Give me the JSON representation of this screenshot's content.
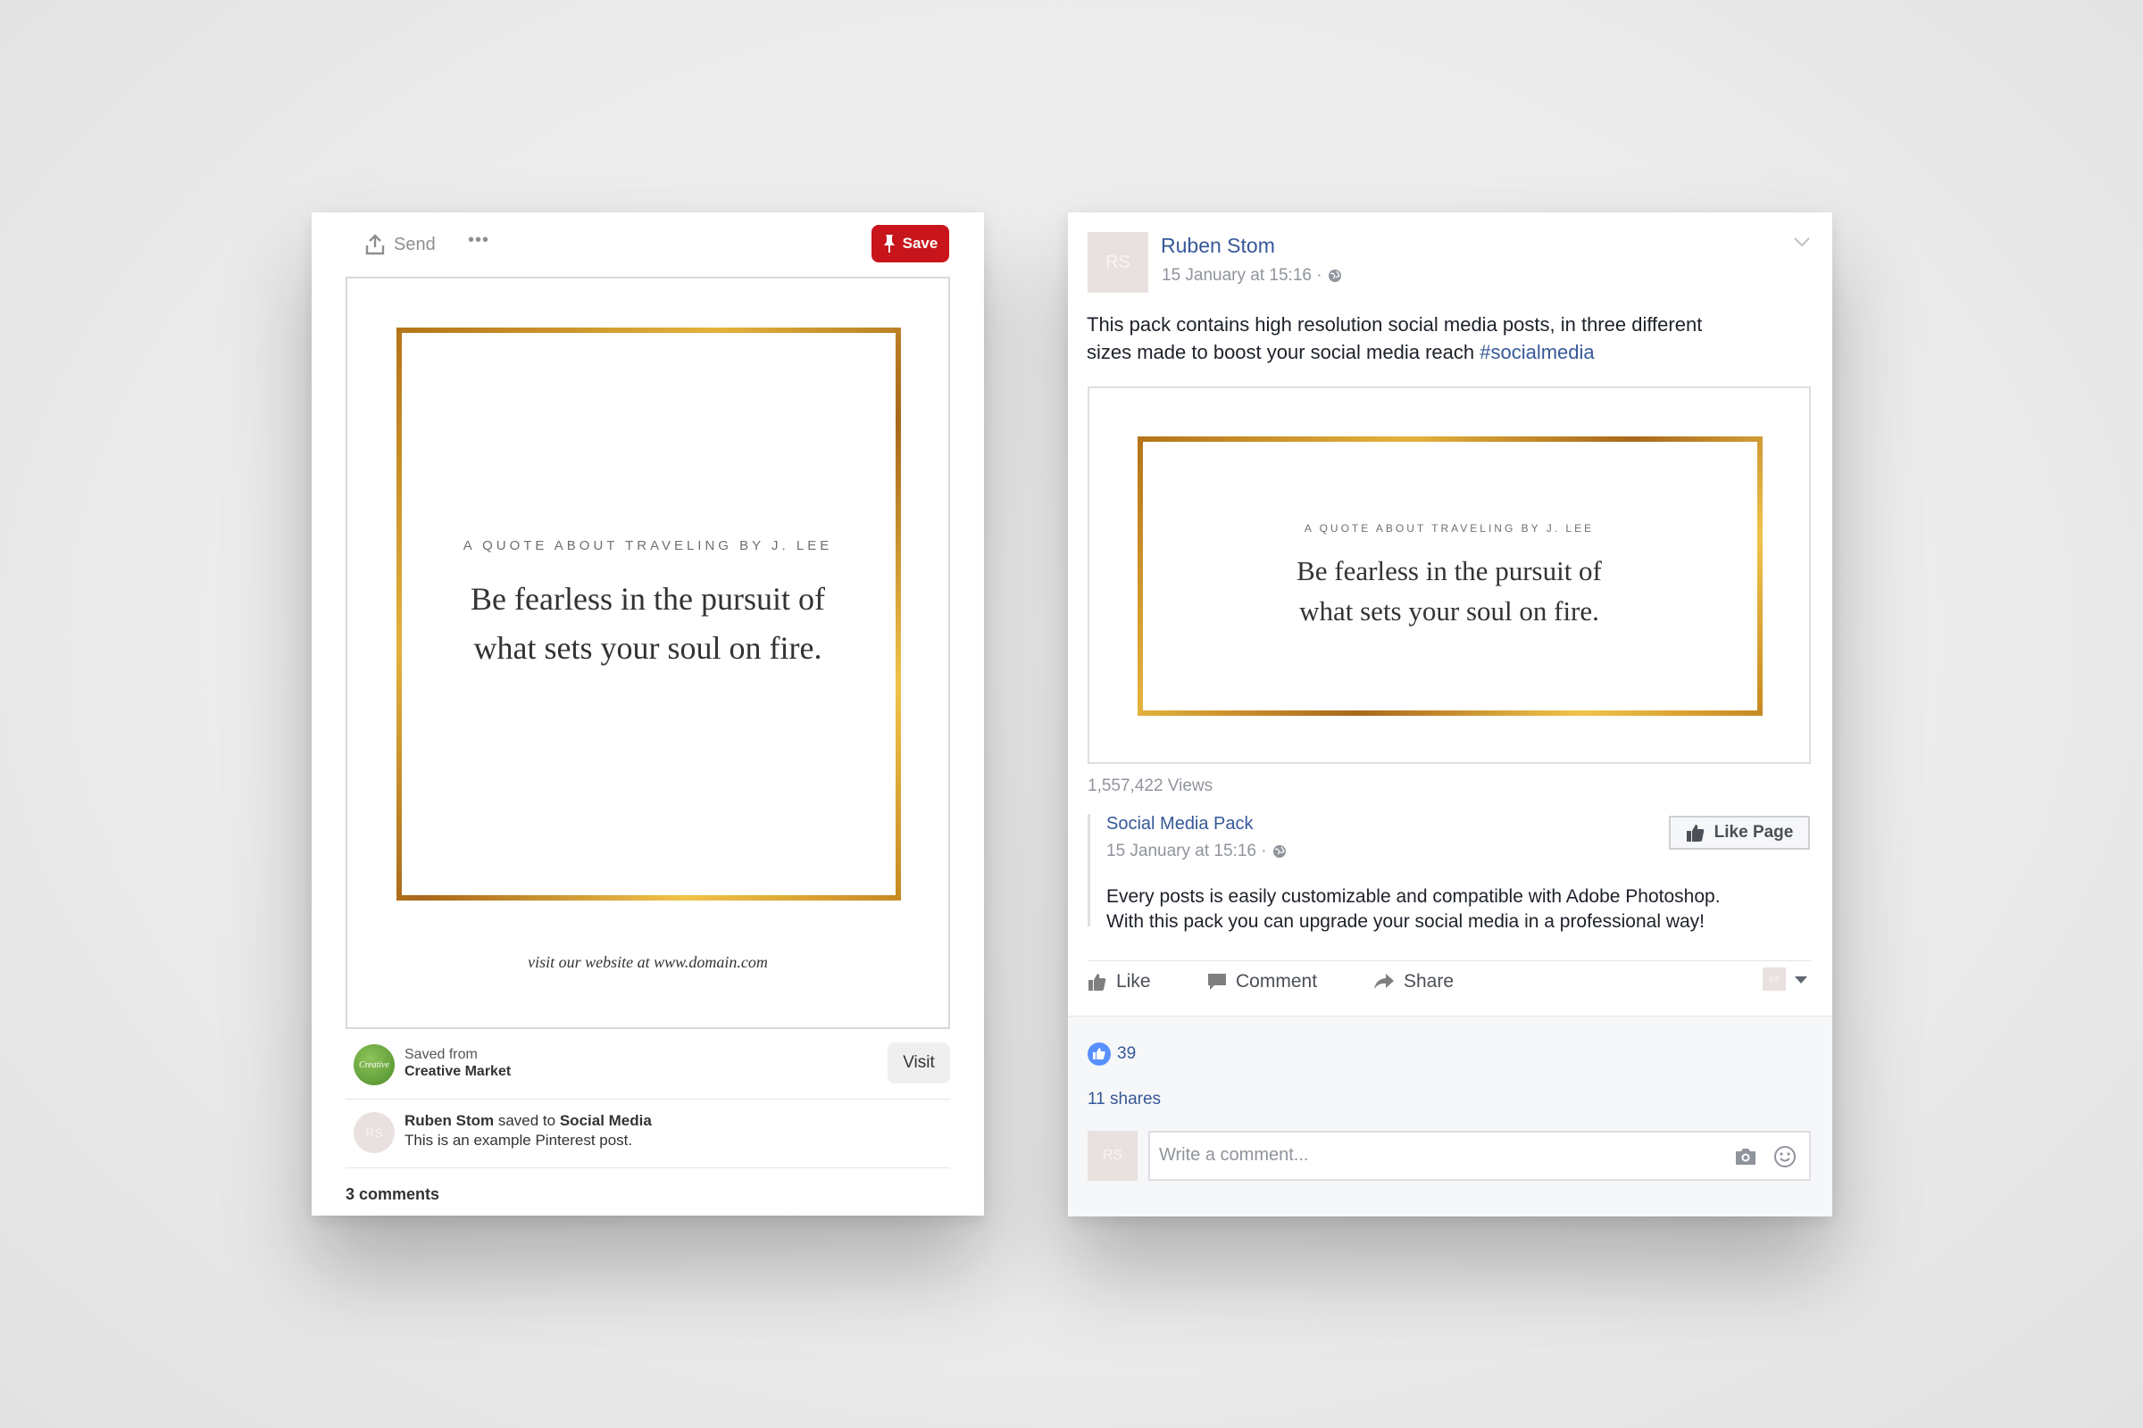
{
  "pinterest": {
    "send_label": "Send",
    "more_label": "•••",
    "save_label": "Save",
    "quote": {
      "title": "A QUOTE ABOUT TRAVELING BY J. LEE",
      "line1": "Be fearless in the pursuit of",
      "line2": "what sets your soul on fire.",
      "footer": "visit our website at www.domain.com"
    },
    "saved_from_label": "Saved from",
    "source_name": "Creative Market",
    "source_logo_text": "Creative",
    "visit_label": "Visit",
    "avatar_initials": "RS",
    "saver_name": "Ruben Stom",
    "saved_to_text": "saved to",
    "board_name": "Social Media",
    "pin_description": "This is an example Pinterest post.",
    "comments_count": "3 comments"
  },
  "facebook": {
    "avatar_initials": "RS",
    "author": "Ruben Stom",
    "timestamp": "15 January at 15:16 ·",
    "post_text_line1": "This pack contains high resolution social media posts, in three different",
    "post_text_line2": "sizes made to boost your social media reach",
    "hashtag": "#socialmedia",
    "quote": {
      "title": "A QUOTE ABOUT TRAVELING BY J. LEE",
      "line1": "Be fearless in the pursuit of",
      "line2": "what sets your soul on fire."
    },
    "views": "1,557,422 Views",
    "shared_page": {
      "name": "Social Media Pack",
      "timestamp": "15 January at 15:16 ·",
      "like_page_label": "Like Page",
      "text_line1": "Every posts is easily customizable and compatible with Adobe Photoshop.",
      "text_line2": "With this pack you can upgrade your social media in a professional way!"
    },
    "actions": {
      "like": "Like",
      "comment": "Comment",
      "share": "Share"
    },
    "reaction_count": "39",
    "shares": "11 shares",
    "comment_placeholder": "Write a comment...",
    "colors": {
      "link": "#365899",
      "like_blue": "#5890ff",
      "pinterest_red": "#c8151b",
      "gold": "#d9a531"
    }
  }
}
